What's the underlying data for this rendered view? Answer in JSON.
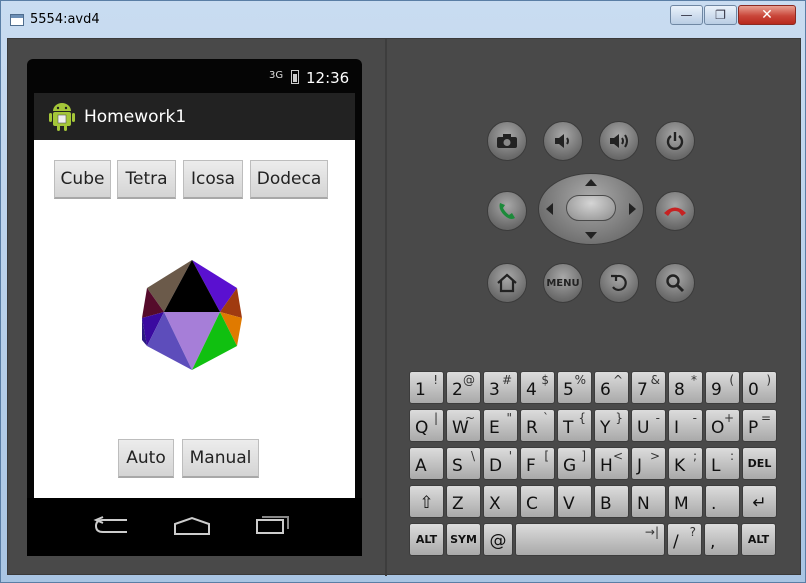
{
  "window": {
    "title": "5554:avd4",
    "min_glyph": "—",
    "max_glyph": "❐",
    "close_glyph": "✕"
  },
  "statusbar": {
    "signal": "3G",
    "time": "12:36"
  },
  "app": {
    "title": "Homework1",
    "shape_buttons": [
      "Cube",
      "Tetra",
      "Icosa",
      "Dodeca"
    ],
    "mode_buttons": [
      "Auto",
      "Manual"
    ]
  },
  "hardware": {
    "menu_label": "MENU",
    "icons": [
      "camera-icon",
      "volume-down-icon",
      "volume-up-icon",
      "power-icon",
      "call-icon",
      "end-call-icon",
      "home-icon",
      "menu-icon",
      "back-icon",
      "search-icon"
    ]
  },
  "keyboard": {
    "row1": [
      {
        "main": "1",
        "alt": "!"
      },
      {
        "main": "2",
        "alt": "@"
      },
      {
        "main": "3",
        "alt": "#"
      },
      {
        "main": "4",
        "alt": "$"
      },
      {
        "main": "5",
        "alt": "%"
      },
      {
        "main": "6",
        "alt": "^"
      },
      {
        "main": "7",
        "alt": "&"
      },
      {
        "main": "8",
        "alt": "*"
      },
      {
        "main": "9",
        "alt": "("
      },
      {
        "main": "0",
        "alt": ")"
      }
    ],
    "row2": [
      {
        "main": "Q",
        "alt": "|"
      },
      {
        "main": "W",
        "alt": "~"
      },
      {
        "main": "E",
        "alt": "\""
      },
      {
        "main": "R",
        "alt": "`"
      },
      {
        "main": "T",
        "alt": "{"
      },
      {
        "main": "Y",
        "alt": "}"
      },
      {
        "main": "U",
        "alt": "-"
      },
      {
        "main": "I",
        "alt": "-"
      },
      {
        "main": "O",
        "alt": "+"
      },
      {
        "main": "P",
        "alt": "="
      }
    ],
    "row3": [
      {
        "main": "A",
        "alt": ""
      },
      {
        "main": "S",
        "alt": "\\"
      },
      {
        "main": "D",
        "alt": "'"
      },
      {
        "main": "F",
        "alt": "["
      },
      {
        "main": "G",
        "alt": "]"
      },
      {
        "main": "H",
        "alt": "<"
      },
      {
        "main": "J",
        "alt": ">"
      },
      {
        "main": "K",
        "alt": ";"
      },
      {
        "main": "L",
        "alt": ":"
      },
      {
        "main": "DEL",
        "alt": ""
      }
    ],
    "row4": [
      {
        "main": "⇧",
        "alt": ""
      },
      {
        "main": "Z",
        "alt": ""
      },
      {
        "main": "X",
        "alt": ""
      },
      {
        "main": "C",
        "alt": ""
      },
      {
        "main": "V",
        "alt": ""
      },
      {
        "main": "B",
        "alt": ""
      },
      {
        "main": "N",
        "alt": ""
      },
      {
        "main": "M",
        "alt": ""
      },
      {
        "main": ".",
        "alt": ""
      },
      {
        "main": "↵",
        "alt": ""
      }
    ],
    "row5": {
      "alt_left": "ALT",
      "sym": "SYM",
      "at": "@",
      "space_alt": "→|",
      "slash": "/",
      "slash_alt": "?",
      "comma": ",",
      "alt_right": "ALT"
    }
  }
}
